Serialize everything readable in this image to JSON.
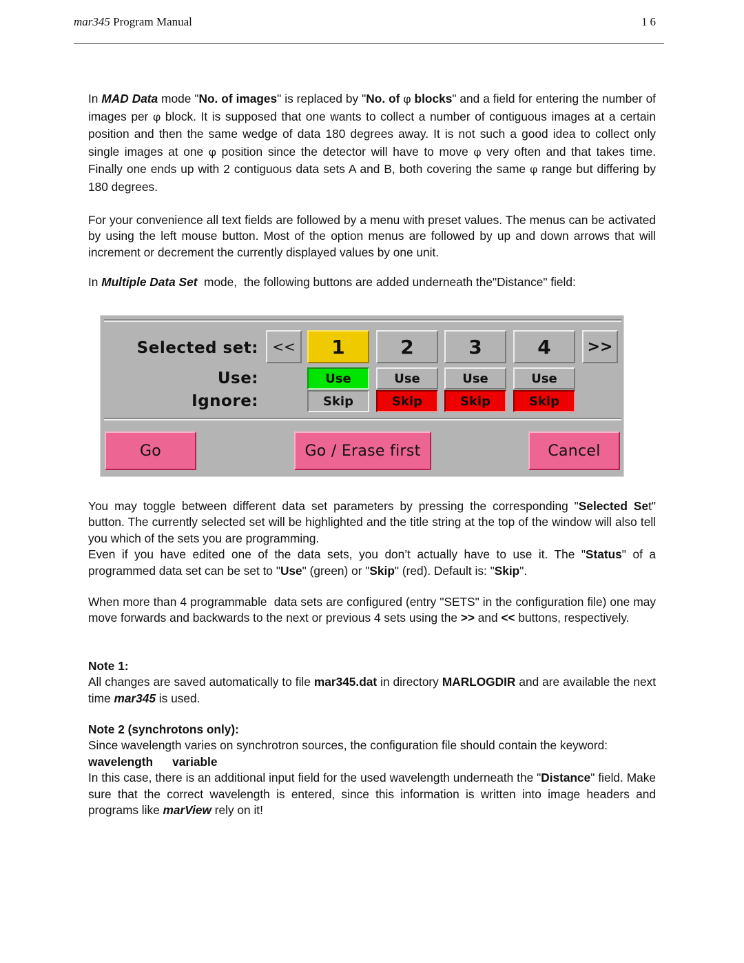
{
  "header": {
    "title_italic": "mar345",
    "title_rest": " Program Manual",
    "page_number": "16"
  },
  "p1": {
    "s1": "In ",
    "mad": "MAD Data",
    "s2": " mode \"",
    "noimages": "No. of images",
    "s3": "\" is replaced by \"",
    "noblocks_a": "No. of ",
    "phi": "φ",
    "noblocks_b": " blocks",
    "s4": "\" and a field for entering the number of images per ",
    "s5": " block. It is supposed that one wants to collect a number of contiguous images at a certain position and then the same wedge of data 180 degrees away. It is not such a good idea to collect only single images at one ",
    "s6": " position since the detector will have to move ",
    "s7": " very often and that takes time. Finally one ends up with 2 contiguous data sets A and B, both covering the same ",
    "s8": " range but differing by 180 degrees."
  },
  "p2": "For your convenience all text fields are followed by a menu with preset values. The menus can be activated by using the left mouse button. Most of the option menus are followed by up and down arrows that will increment or decrement the currently displayed values by one unit.",
  "p3": {
    "s1": "In ",
    "mode": "Multiple Data Set",
    "s2": "  mode,  the following buttons are added underneath the\"Distance\" field:"
  },
  "widget": {
    "selected_set_label": "Selected set:",
    "use_label": "Use:",
    "ignore_label": "Ignore:",
    "prev_button": "<<",
    "next_button": ">>",
    "sets": [
      {
        "label": "1",
        "selected": true,
        "status": "Use"
      },
      {
        "label": "2",
        "selected": false,
        "status": "Skip"
      },
      {
        "label": "3",
        "selected": false,
        "status": "Skip"
      },
      {
        "label": "4",
        "selected": false,
        "status": "Skip"
      }
    ],
    "use_button": "Use",
    "skip_button": "Skip",
    "go_button": "Go",
    "go_erase_button": "Go / Erase first",
    "cancel_button": "Cancel",
    "colors": {
      "panel": "#b4b4b4",
      "selected": "#efca00",
      "use_active": "#00e500",
      "skip_active": "#ee0000",
      "action": "#ec6593"
    }
  },
  "p4": {
    "s1": "You may toggle between different data set parameters by pressing the corresponding \"",
    "b1": "Selected Se",
    "s2": "t\" button. The currently selected set will be highlighted and the title string at the top of the window will also tell you which of the sets you are programming.",
    "s3": "Even if you have edited one of the data sets, you don’t actually have to use it. The \"",
    "b2": "Status",
    "s4": "\" of a programmed data set can be set to \"",
    "b3": "Use",
    "s5": "\" (green) or \"",
    "b4": "Skip",
    "s6": "\" (red). Default is: \"",
    "b5": "Skip",
    "s7": "\"."
  },
  "p5": {
    "s1": "When more than 4 programmable  data sets are configured (entry \"SETS\" in the configuration file) one may move forwards and backwards to the next or previous 4 sets using the ",
    "b1": ">>",
    "s2": " and ",
    "b2": "<<",
    "s3": " buttons, respectively."
  },
  "note1": {
    "heading": "Note 1:",
    "s1": "All changes are saved automatically to file ",
    "file": "mar345.dat",
    "s2": " in directory ",
    "dir": "MARLOGDIR",
    "s3": " and are available the next time ",
    "prog": "mar345",
    "s4": " is used."
  },
  "note2": {
    "heading": "Note 2 (synchrotons only):",
    "s1": "Since wavelength varies on synchrotron sources, the configuration file should contain the keyword:",
    "kw1": "wavelength",
    "kw2": "variable",
    "s2": "In this case, there is an additional input field for the used wavelength underneath the \"",
    "b1": "Distance",
    "s3": "\" field. Make sure that the correct wavelength is entered, since this information is written into image headers and programs like ",
    "prog": "marView",
    "s4": " rely on it!"
  }
}
